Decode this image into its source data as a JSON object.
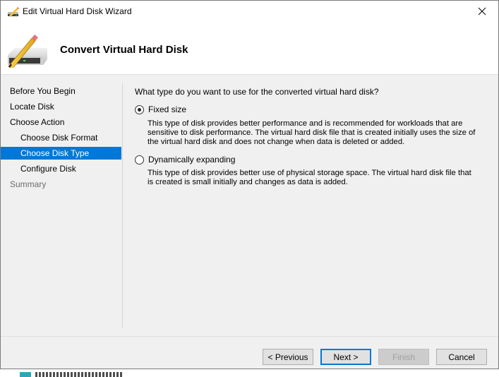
{
  "window": {
    "title": "Edit Virtual Hard Disk Wizard",
    "header_title": "Convert Virtual Hard Disk",
    "icons": {
      "title": "disk-pencil-icon",
      "header": "disk-pencil-icon",
      "close": "close-icon"
    }
  },
  "sidebar": {
    "items": [
      {
        "label": "Before You Begin",
        "level": "top",
        "state": "normal"
      },
      {
        "label": "Locate Disk",
        "level": "top",
        "state": "normal"
      },
      {
        "label": "Choose Action",
        "level": "top",
        "state": "normal"
      },
      {
        "label": "Choose Disk Format",
        "level": "sub",
        "state": "normal"
      },
      {
        "label": "Choose Disk Type",
        "level": "sub",
        "state": "selected"
      },
      {
        "label": "Configure Disk",
        "level": "sub",
        "state": "normal"
      },
      {
        "label": "Summary",
        "level": "top",
        "state": "disabled"
      }
    ]
  },
  "content": {
    "question": "What type do you want to use for the converted virtual hard disk?",
    "options": [
      {
        "label": "Fixed size",
        "checked": true,
        "description": "This type of disk provides better performance and is recommended for workloads that are sensitive to disk performance. The virtual hard disk file that is created initially uses the size of the virtual hard disk and does not change when data is deleted or added."
      },
      {
        "label": "Dynamically expanding",
        "checked": false,
        "description": "This type of disk provides better use of physical storage space. The virtual hard disk file that is created is small initially and changes as data is added."
      }
    ]
  },
  "footer": {
    "previous_label": "< Previous",
    "next_label": "Next >",
    "finish_label": "Finish",
    "cancel_label": "Cancel"
  },
  "colors": {
    "accent": "#0078d7",
    "window_bg": "#f0f0f0",
    "header_bg": "#ffffff"
  }
}
